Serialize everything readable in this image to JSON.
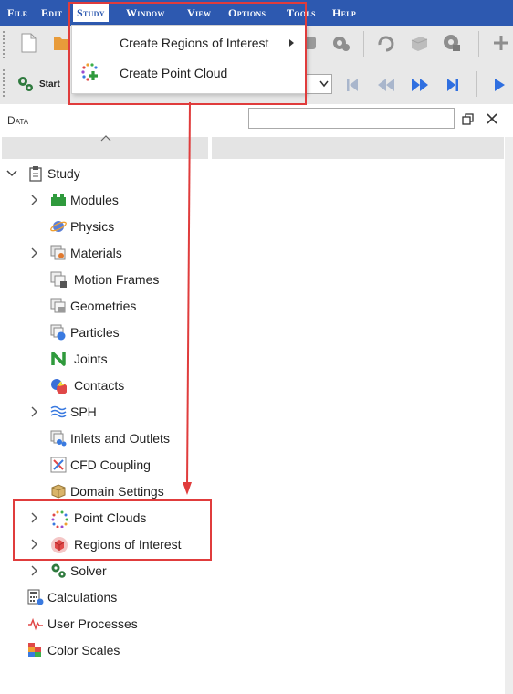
{
  "menubar": {
    "items": [
      "File",
      "Edit",
      "Study",
      "Window",
      "View",
      "Options",
      "Tools",
      "Help"
    ]
  },
  "toolbar": {
    "start_label": "Start"
  },
  "study_menu": {
    "items": [
      {
        "label": "Create Regions of Interest",
        "icon": "regions-icon",
        "has_submenu": true
      },
      {
        "label": "Create Point Cloud",
        "icon": "point-cloud-icon",
        "has_submenu": false
      }
    ]
  },
  "panel": {
    "title": "Data",
    "search_value": ""
  },
  "tree": {
    "root": "Study",
    "children": [
      {
        "label": "Modules",
        "icon": "modules-icon",
        "expandable": true
      },
      {
        "label": "Physics",
        "icon": "physics-icon",
        "expandable": false
      },
      {
        "label": "Materials",
        "icon": "materials-icon",
        "expandable": true
      },
      {
        "label": "Motion Frames",
        "icon": "motion-frames-icon",
        "expandable": false
      },
      {
        "label": "Geometries",
        "icon": "geometries-icon",
        "expandable": false
      },
      {
        "label": "Particles",
        "icon": "particles-icon",
        "expandable": false
      },
      {
        "label": "Joints",
        "icon": "joints-icon",
        "expandable": false
      },
      {
        "label": "Contacts",
        "icon": "contacts-icon",
        "expandable": false
      },
      {
        "label": "SPH",
        "icon": "sph-icon",
        "expandable": true
      },
      {
        "label": "Inlets and Outlets",
        "icon": "inlets-icon",
        "expandable": false
      },
      {
        "label": "CFD Coupling",
        "icon": "cfd-icon",
        "expandable": false
      },
      {
        "label": "Domain Settings",
        "icon": "domain-icon",
        "expandable": false
      },
      {
        "label": "Point Clouds",
        "icon": "point-cloud-icon",
        "expandable": true
      },
      {
        "label": "Regions of Interest",
        "icon": "regions-icon",
        "expandable": true
      },
      {
        "label": "Solver",
        "icon": "solver-icon",
        "expandable": true
      }
    ],
    "top_level": [
      {
        "label": "Calculations",
        "icon": "calculator-icon"
      },
      {
        "label": "User Processes",
        "icon": "user-process-icon"
      },
      {
        "label": "Color Scales",
        "icon": "color-scales-icon"
      }
    ]
  },
  "colors": {
    "menubar": "#2d59b0",
    "highlight": "#e03c3c",
    "toolbar": "#e8e8e8"
  }
}
